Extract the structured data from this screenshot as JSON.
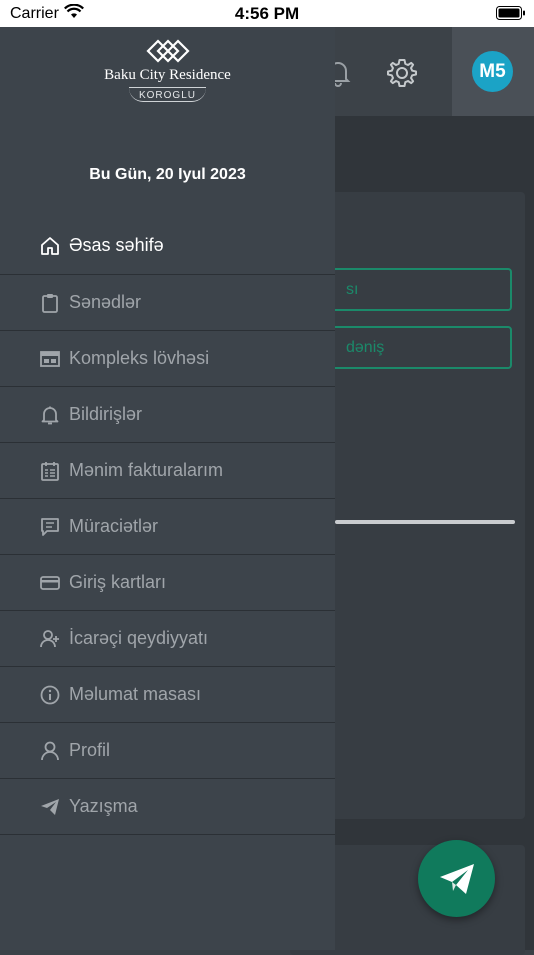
{
  "status_bar": {
    "carrier": "Carrier",
    "time": "4:56 PM"
  },
  "brand": {
    "name": "Baku City Residence",
    "subtitle": "KOROGLU"
  },
  "drawer": {
    "date": "Bu Gün, 20 Iyul 2023",
    "items": [
      {
        "label": "Əsas səhifə",
        "icon": "home-icon",
        "active": true
      },
      {
        "label": "Sənədlər",
        "icon": "clipboard-icon",
        "active": false
      },
      {
        "label": "Kompleks lövhəsi",
        "icon": "board-icon",
        "active": false
      },
      {
        "label": "Bildirişlər",
        "icon": "bell-icon",
        "active": false
      },
      {
        "label": "Mənim fakturalarım",
        "icon": "invoice-icon",
        "active": false
      },
      {
        "label": "Müraciətlər",
        "icon": "message-icon",
        "active": false
      },
      {
        "label": "Giriş kartları",
        "icon": "card-icon",
        "active": false
      },
      {
        "label": "İcarəçi qeydiyyatı",
        "icon": "add-user-icon",
        "active": false
      },
      {
        "label": "Məlumat masası",
        "icon": "info-icon",
        "active": false
      },
      {
        "label": "Profil",
        "icon": "user-icon",
        "active": false
      },
      {
        "label": "Yazışma",
        "icon": "send-icon",
        "active": false
      }
    ]
  },
  "background": {
    "avatar_initials": "M5",
    "button1_text": "sı",
    "button2_text": "dəniş"
  },
  "colors": {
    "accent": "#107a5c",
    "avatar": "#1ba3c6",
    "drawer": "#3d444b"
  }
}
